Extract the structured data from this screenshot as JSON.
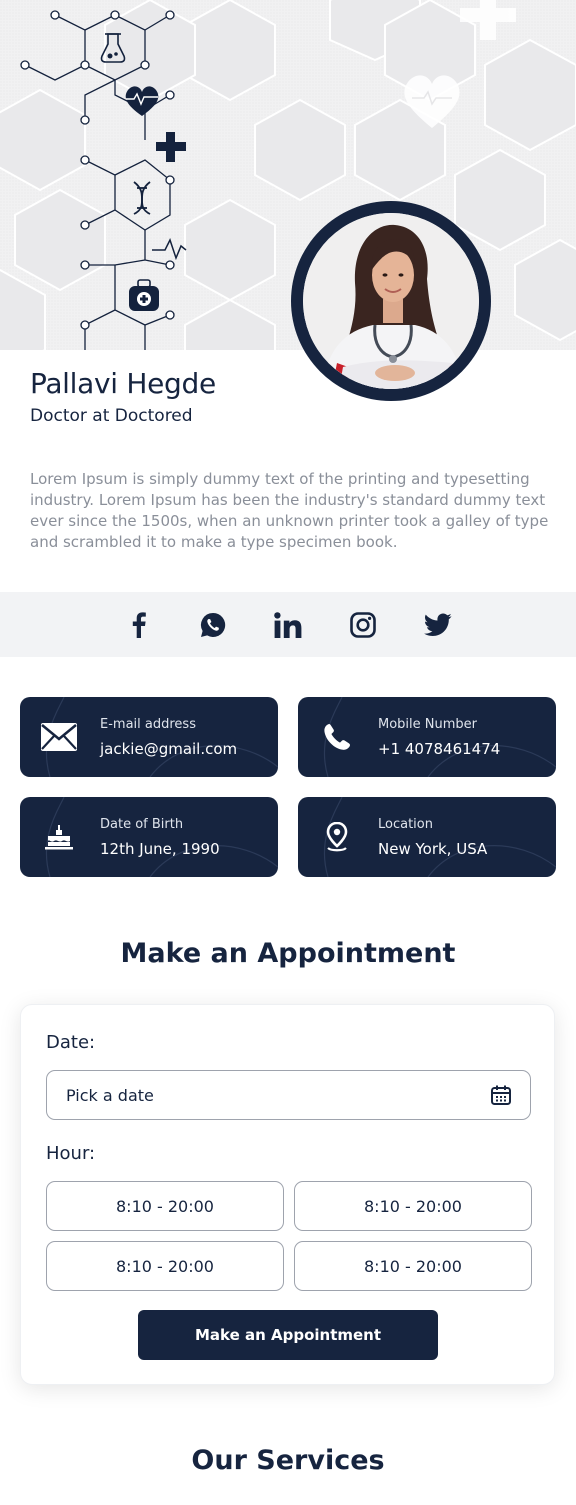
{
  "profile": {
    "name": "Pallavi Hegde",
    "role": "Doctor at Doctored",
    "bio": "Lorem Ipsum is simply dummy text of the printing and typesetting industry. Lorem Ipsum has been the industry's standard dummy text ever since the 1500s, when an unknown printer took a galley of type and scrambled it to make a type specimen book."
  },
  "social": [
    {
      "icon": "facebook-icon"
    },
    {
      "icon": "whatsapp-icon"
    },
    {
      "icon": "linkedin-icon"
    },
    {
      "icon": "instagram-icon"
    },
    {
      "icon": "twitter-icon"
    }
  ],
  "info": [
    {
      "label": "E-mail address",
      "value": "jackie@gmail.com",
      "icon": "mail-icon"
    },
    {
      "label": "Mobile Number",
      "value": "+1 4078461474",
      "icon": "phone-icon"
    },
    {
      "label": "Date of Birth",
      "value": "12th June, 1990",
      "icon": "cake-icon"
    },
    {
      "label": "Location",
      "value": "New York, USA",
      "icon": "location-pin-icon"
    }
  ],
  "appointment": {
    "title": "Make an Appointment",
    "date_label": "Date:",
    "date_placeholder": "Pick a date",
    "hour_label": "Hour:",
    "slots": [
      "8:10 - 20:00",
      "8:10 - 20:00",
      "8:10 - 20:00",
      "8:10 - 20:00"
    ],
    "submit_label": "Make an Appointment"
  },
  "services": {
    "title": "Our Services"
  },
  "colors": {
    "primary": "#16243f",
    "muted_text": "#8a8f99",
    "hero_bg": "#f3f3f4",
    "social_bar_bg": "#f2f3f5"
  }
}
